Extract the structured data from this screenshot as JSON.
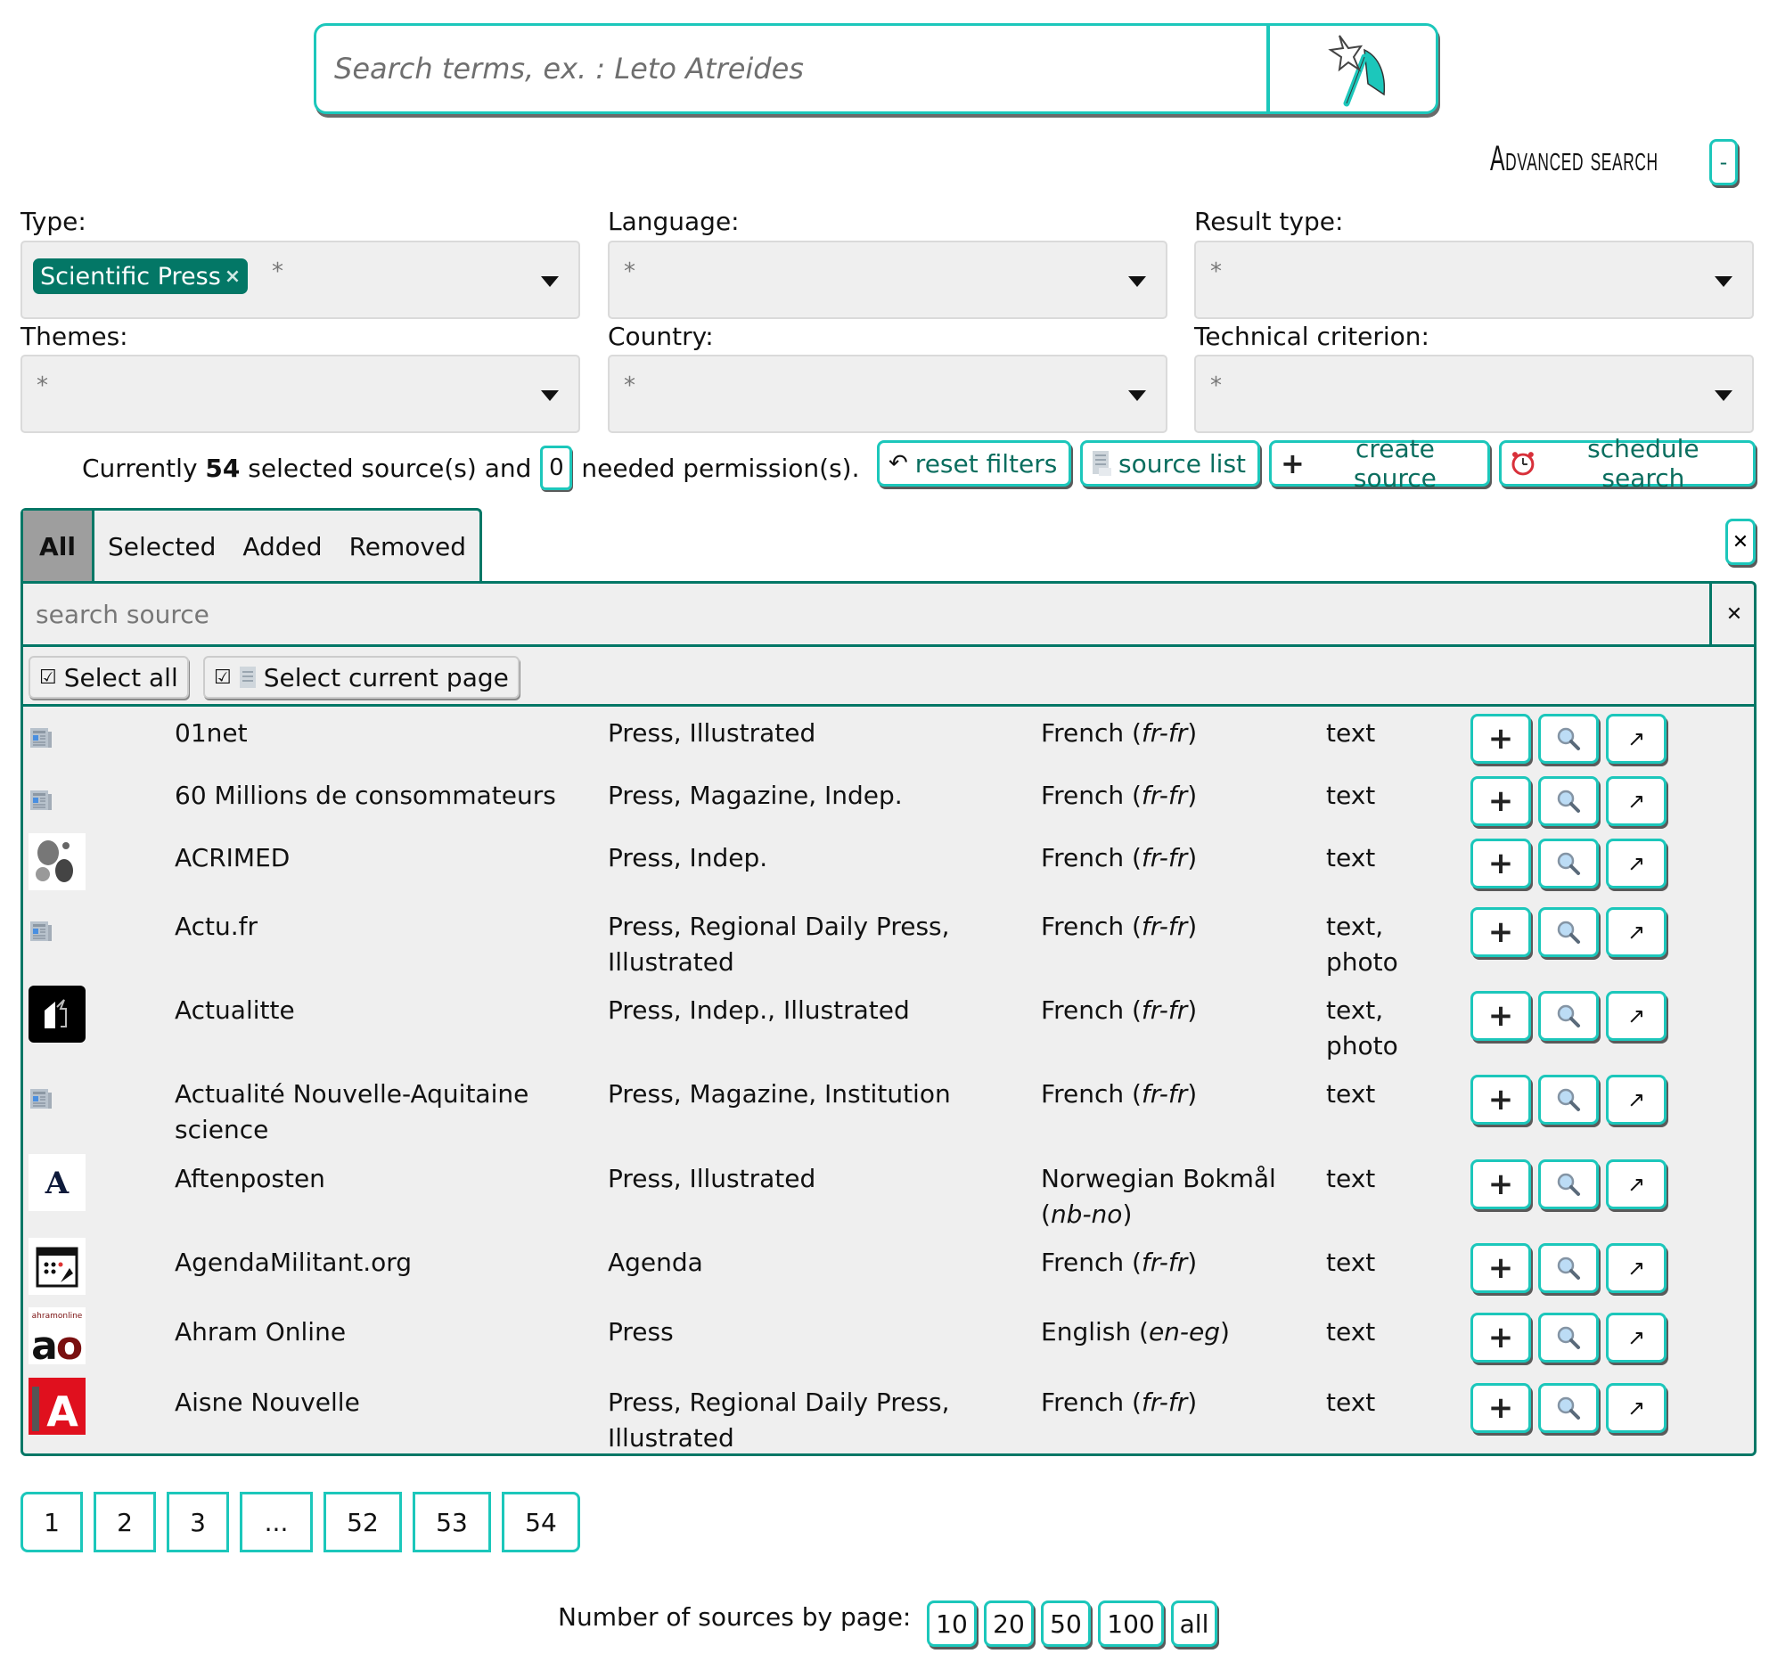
{
  "search": {
    "placeholder": "Search terms, ex. : Leto Atreides",
    "value": "",
    "submit_icon": "axe-wand-icon"
  },
  "advanced_search": {
    "label": "Advanced search",
    "toggle_label": "-"
  },
  "filters": [
    {
      "label": "Type:",
      "chips": [
        "Scientific Press"
      ],
      "placeholder": "*"
    },
    {
      "label": "Language:",
      "chips": [],
      "placeholder": "*"
    },
    {
      "label": "Result type:",
      "chips": [],
      "placeholder": "*"
    },
    {
      "label": "Themes:",
      "chips": [],
      "placeholder": "*"
    },
    {
      "label": "Country:",
      "chips": [],
      "placeholder": "*"
    },
    {
      "label": "Technical criterion:",
      "chips": [],
      "placeholder": "*"
    }
  ],
  "status": {
    "prefix": "Currently",
    "selected_count": "54",
    "middle": "selected source(s) and",
    "permission_count": "0",
    "suffix": "needed permission(s)."
  },
  "actions": {
    "reset_filters": "reset filters",
    "source_list": "source list",
    "create_source": "create source",
    "schedule_search": "schedule search"
  },
  "tabs": [
    {
      "label": "All",
      "active": true
    },
    {
      "label": "Selected",
      "active": false
    },
    {
      "label": "Added",
      "active": false
    },
    {
      "label": "Removed",
      "active": false
    }
  ],
  "source_search": {
    "placeholder": "search source",
    "value": ""
  },
  "select_all_label": "Select all",
  "select_page_label": "Select current page",
  "sources": [
    {
      "name": "01net",
      "types": "Press, Illustrated",
      "lang": "French",
      "code": "fr-fr",
      "media": "text",
      "logo": "newspaper-icon"
    },
    {
      "name": "60 Millions de consommateurs",
      "types": "Press, Magazine, Indep.",
      "lang": "French",
      "code": "fr-fr",
      "media": "text",
      "logo": "newspaper-icon"
    },
    {
      "name": "ACRIMED",
      "types": "Press, Indep.",
      "lang": "French",
      "code": "fr-fr",
      "media": "text",
      "logo": "acrimed-logo"
    },
    {
      "name": "Actu.fr",
      "types": "Press, Regional Daily Press, Illustrated",
      "lang": "French",
      "code": "fr-fr",
      "media": "text, photo",
      "logo": "newspaper-icon"
    },
    {
      "name": "Actualitte",
      "types": "Press, Indep., Illustrated",
      "lang": "French",
      "code": "fr-fr",
      "media": "text, photo",
      "logo": "actualitte-logo"
    },
    {
      "name": "Actualité Nouvelle-Aquitaine science",
      "types": "Press, Magazine, Institution",
      "lang": "French",
      "code": "fr-fr",
      "media": "text",
      "logo": "newspaper-icon"
    },
    {
      "name": "Aftenposten",
      "types": "Press, Illustrated",
      "lang": "Norwegian Bokmål",
      "code": "nb-no",
      "media": "text",
      "logo": "aftenposten-logo"
    },
    {
      "name": "AgendaMilitant.org",
      "types": "Agenda",
      "lang": "French",
      "code": "fr-fr",
      "media": "text",
      "logo": "calendar-logo"
    },
    {
      "name": "Ahram Online",
      "types": "Press",
      "lang": "English",
      "code": "en-eg",
      "media": "text",
      "logo": "ahram-logo"
    },
    {
      "name": "Aisne Nouvelle",
      "types": "Press, Regional Daily Press, Illustrated",
      "lang": "French",
      "code": "fr-fr",
      "media": "text",
      "logo": "aisne-logo"
    }
  ],
  "pagination": [
    "1",
    "2",
    "3",
    "...",
    "52",
    "53",
    "54"
  ],
  "per_page": {
    "label": "Number of sources by page:",
    "options": [
      "10",
      "20",
      "50",
      "100",
      "all"
    ]
  },
  "colors": {
    "accent": "#1cc7bb",
    "dark_teal": "#037766",
    "panel_bg": "#efefef"
  }
}
